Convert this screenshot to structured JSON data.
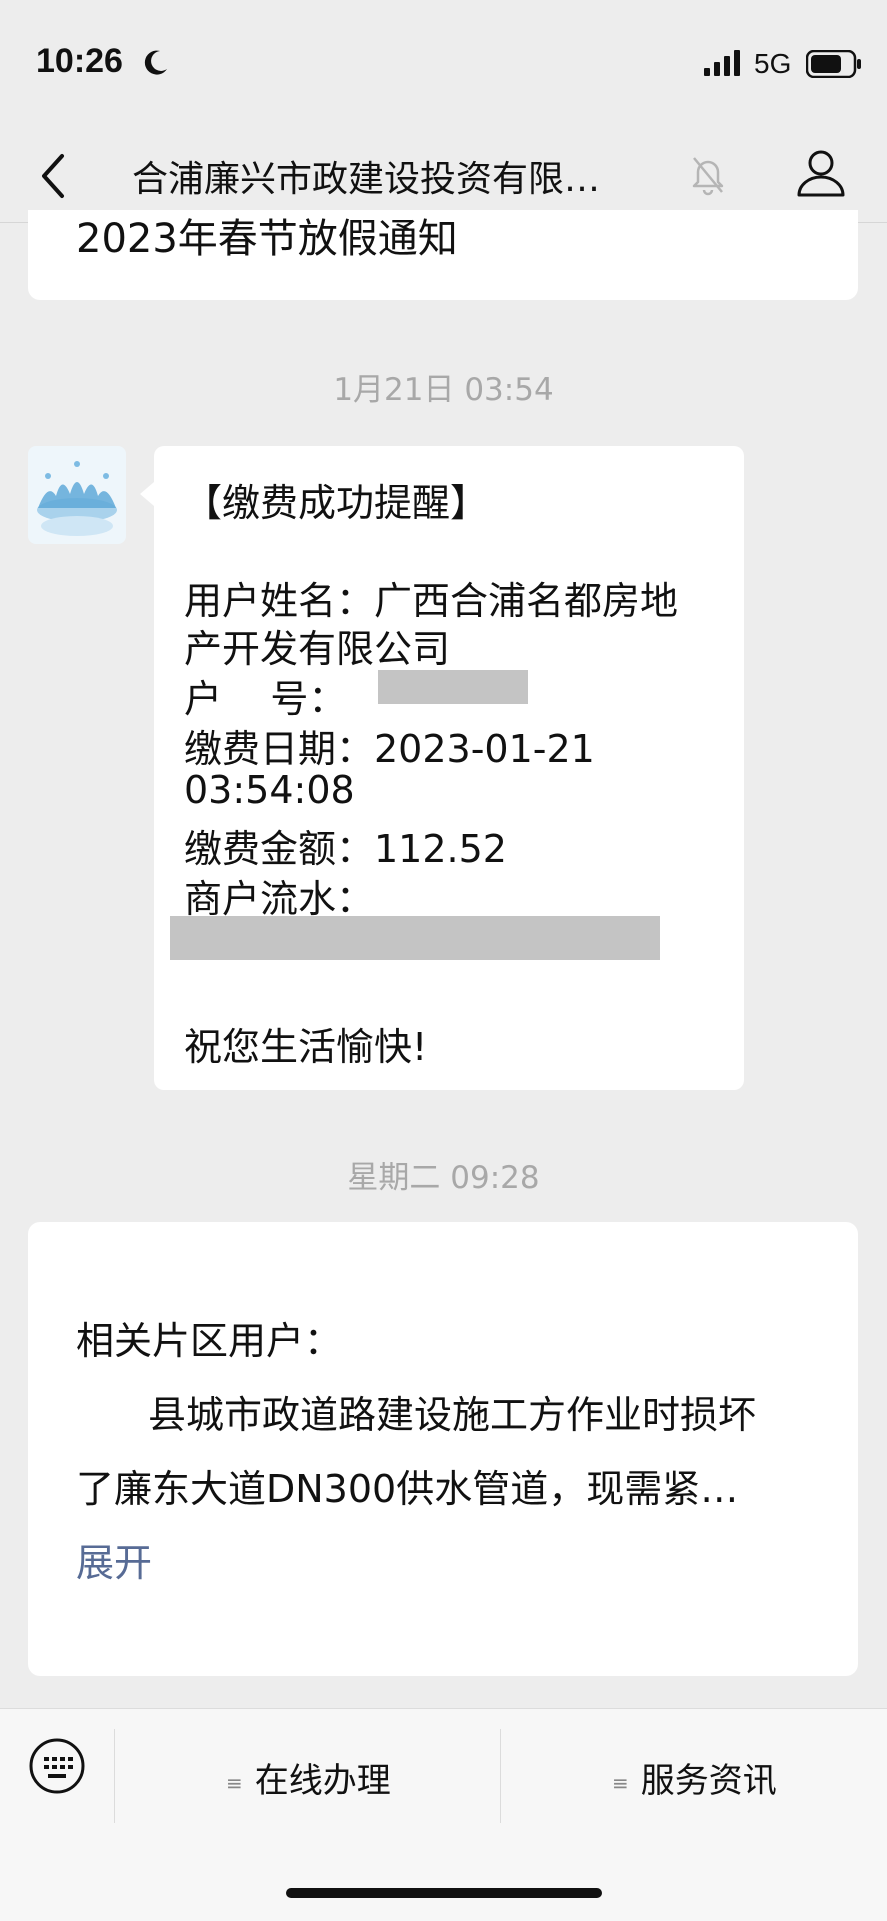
{
  "status_bar": {
    "time": "10:26",
    "network": "5G"
  },
  "nav": {
    "title": "合浦廉兴市政建设投资有限…"
  },
  "previous_message": {
    "title": "2023年春节放假通知"
  },
  "message1": {
    "timestamp": "1月21日 03:54",
    "header": "【缴费成功提醒】",
    "name_line1": "用户姓名：广西合浦名都房地",
    "name_line2": "产开发有限公司",
    "account_label": "户    号：",
    "date_line1": "缴费日期：2023-01-21",
    "date_line2": "03:54:08",
    "amount_line": "缴费金额：112.52",
    "serial_label": "商户流水：",
    "closing": "祝您生活愉快!"
  },
  "message2": {
    "timestamp": "星期二 09:28",
    "line1": "相关片区用户：",
    "line2": "县城市政道路建设施工方作业时损坏",
    "line3": "了廉东大道DN300供水管道，现需紧…",
    "expand": "展开"
  },
  "bottom_menu": {
    "item1": "在线办理",
    "item2": "服务资讯"
  }
}
